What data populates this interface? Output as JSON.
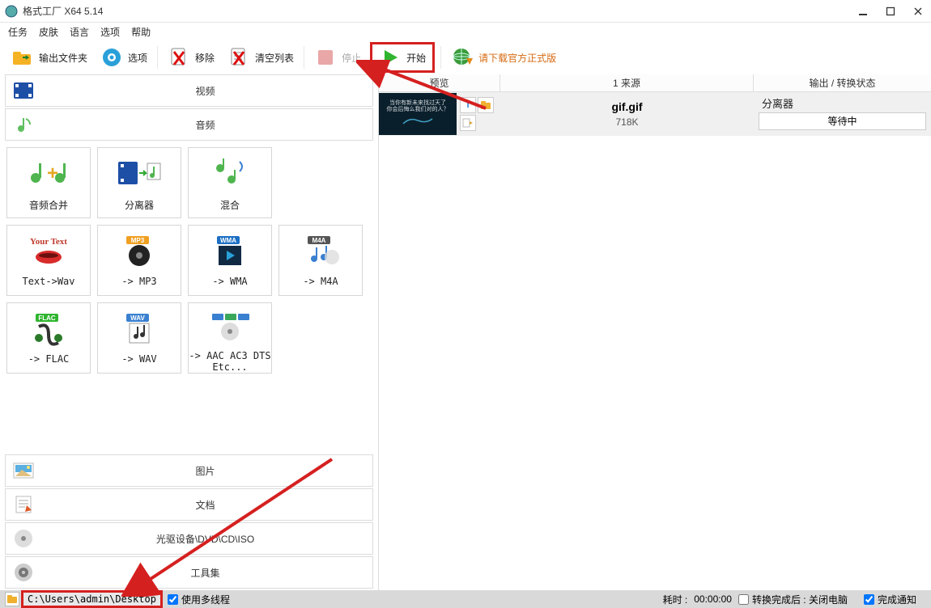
{
  "titlebar": {
    "title": "格式工厂 X64 5.14"
  },
  "menubar": {
    "items": [
      "任务",
      "皮肤",
      "语言",
      "选项",
      "帮助"
    ]
  },
  "toolbar": {
    "output_folder": "输出文件夹",
    "options": "选项",
    "remove": "移除",
    "clear": "清空列表",
    "stop": "停止",
    "start": "开始",
    "download": "请下载官方正式版"
  },
  "categories": {
    "video": "视频",
    "audio": "音频",
    "picture": "图片",
    "document": "文档",
    "optical": "光驱设备\\DVD\\CD\\ISO",
    "toolset": "工具集"
  },
  "tiles": {
    "merge": "音频合并",
    "splitter": "分离器",
    "mix": "混合",
    "textwav": "Text->Wav",
    "mp3": "-> MP3",
    "wma": "-> WMA",
    "m4a": "-> M4A",
    "flac": "-> FLAC",
    "wav": "-> WAV",
    "aac": "-> AAC AC3 DTS Etc..."
  },
  "table": {
    "headers": {
      "preview": "预览",
      "source": "1 来源",
      "status": "输出 / 转换状态"
    },
    "row": {
      "filename": "gif.gif",
      "filesize": "718K",
      "operation": "分离器",
      "state": "等待中"
    }
  },
  "statusbar": {
    "path": "C:\\Users\\admin\\Desktop",
    "multithread": "使用多线程",
    "elapsed_label": "耗时 :",
    "elapsed_value": "00:00:00",
    "after_done": "转换完成后 : 关闭电脑",
    "notify": "完成通知"
  }
}
